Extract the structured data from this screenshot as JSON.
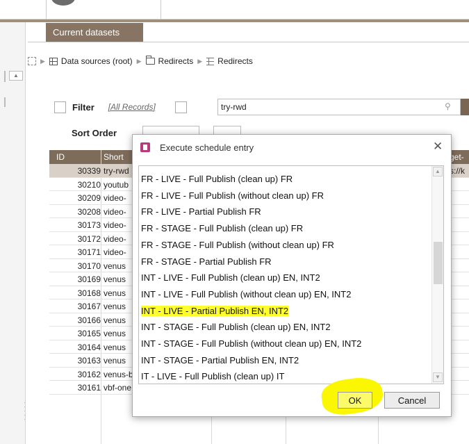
{
  "app": {
    "tab_title": "Current datasets"
  },
  "breadcrumb": {
    "items": [
      {
        "label": "Data sources (root)",
        "icon": "grid-icon"
      },
      {
        "label": "Redirects",
        "icon": "folder-icon"
      },
      {
        "label": "Redirects",
        "icon": "table-icon"
      }
    ]
  },
  "filter": {
    "label": "Filter",
    "all_records": "[All Records]",
    "search_value": "try-rwd"
  },
  "sort": {
    "label": "Sort Order"
  },
  "grid": {
    "columns": {
      "id": "ID",
      "short": "Short",
      "target": "get-"
    },
    "rows": [
      {
        "id": "30339",
        "name": "try-rwd",
        "target": "s://k",
        "selected": true
      },
      {
        "id": "30210",
        "name": "youtub"
      },
      {
        "id": "30209",
        "name": "video-"
      },
      {
        "id": "30208",
        "name": "video-"
      },
      {
        "id": "30173",
        "name": "video-"
      },
      {
        "id": "30172",
        "name": "video-"
      },
      {
        "id": "30171",
        "name": "video-"
      },
      {
        "id": "30170",
        "name": "venus"
      },
      {
        "id": "30169",
        "name": "venus"
      },
      {
        "id": "30168",
        "name": "venus"
      },
      {
        "id": "30167",
        "name": "venus"
      },
      {
        "id": "30166",
        "name": "venus"
      },
      {
        "id": "30165",
        "name": "venus"
      },
      {
        "id": "30164",
        "name": "venus"
      },
      {
        "id": "30163",
        "name": "venus"
      },
      {
        "id": "30162",
        "name": "venus-bulkfill"
      },
      {
        "id": "30161",
        "name": "vbf-one"
      }
    ]
  },
  "dialog": {
    "title": "Execute schedule entry",
    "close": "✕",
    "entries": [
      "FR - LIVE - Full Publish (clean up) FR",
      "FR - LIVE - Full Publish (without clean up) FR",
      "FR - LIVE - Partial Publish FR",
      "FR - STAGE - Full Publish (clean up) FR",
      "FR - STAGE - Full Publish (without clean up) FR",
      "FR - STAGE - Partial Publish FR",
      "INT - LIVE - Full Publish (clean up) EN, INT2",
      "INT - LIVE - Full Publish (without clean up) EN, INT2",
      "INT - LIVE - Partial Publish EN, INT2",
      "INT - STAGE - Full Publish (clean up) EN, INT2",
      "INT - STAGE - Full Publish (without clean up) EN, INT2",
      "INT - STAGE - Partial Publish EN, INT2",
      "IT - LIVE - Full Publish (clean up) IT"
    ],
    "highlighted_entry": "INT - LIVE - Partial Publish EN, INT2",
    "ok_label": "OK",
    "cancel_label": "Cancel",
    "highlight_color": "#ffff2b"
  },
  "colors": {
    "accent": "#887462",
    "grid_header": "#7e6c5b"
  }
}
